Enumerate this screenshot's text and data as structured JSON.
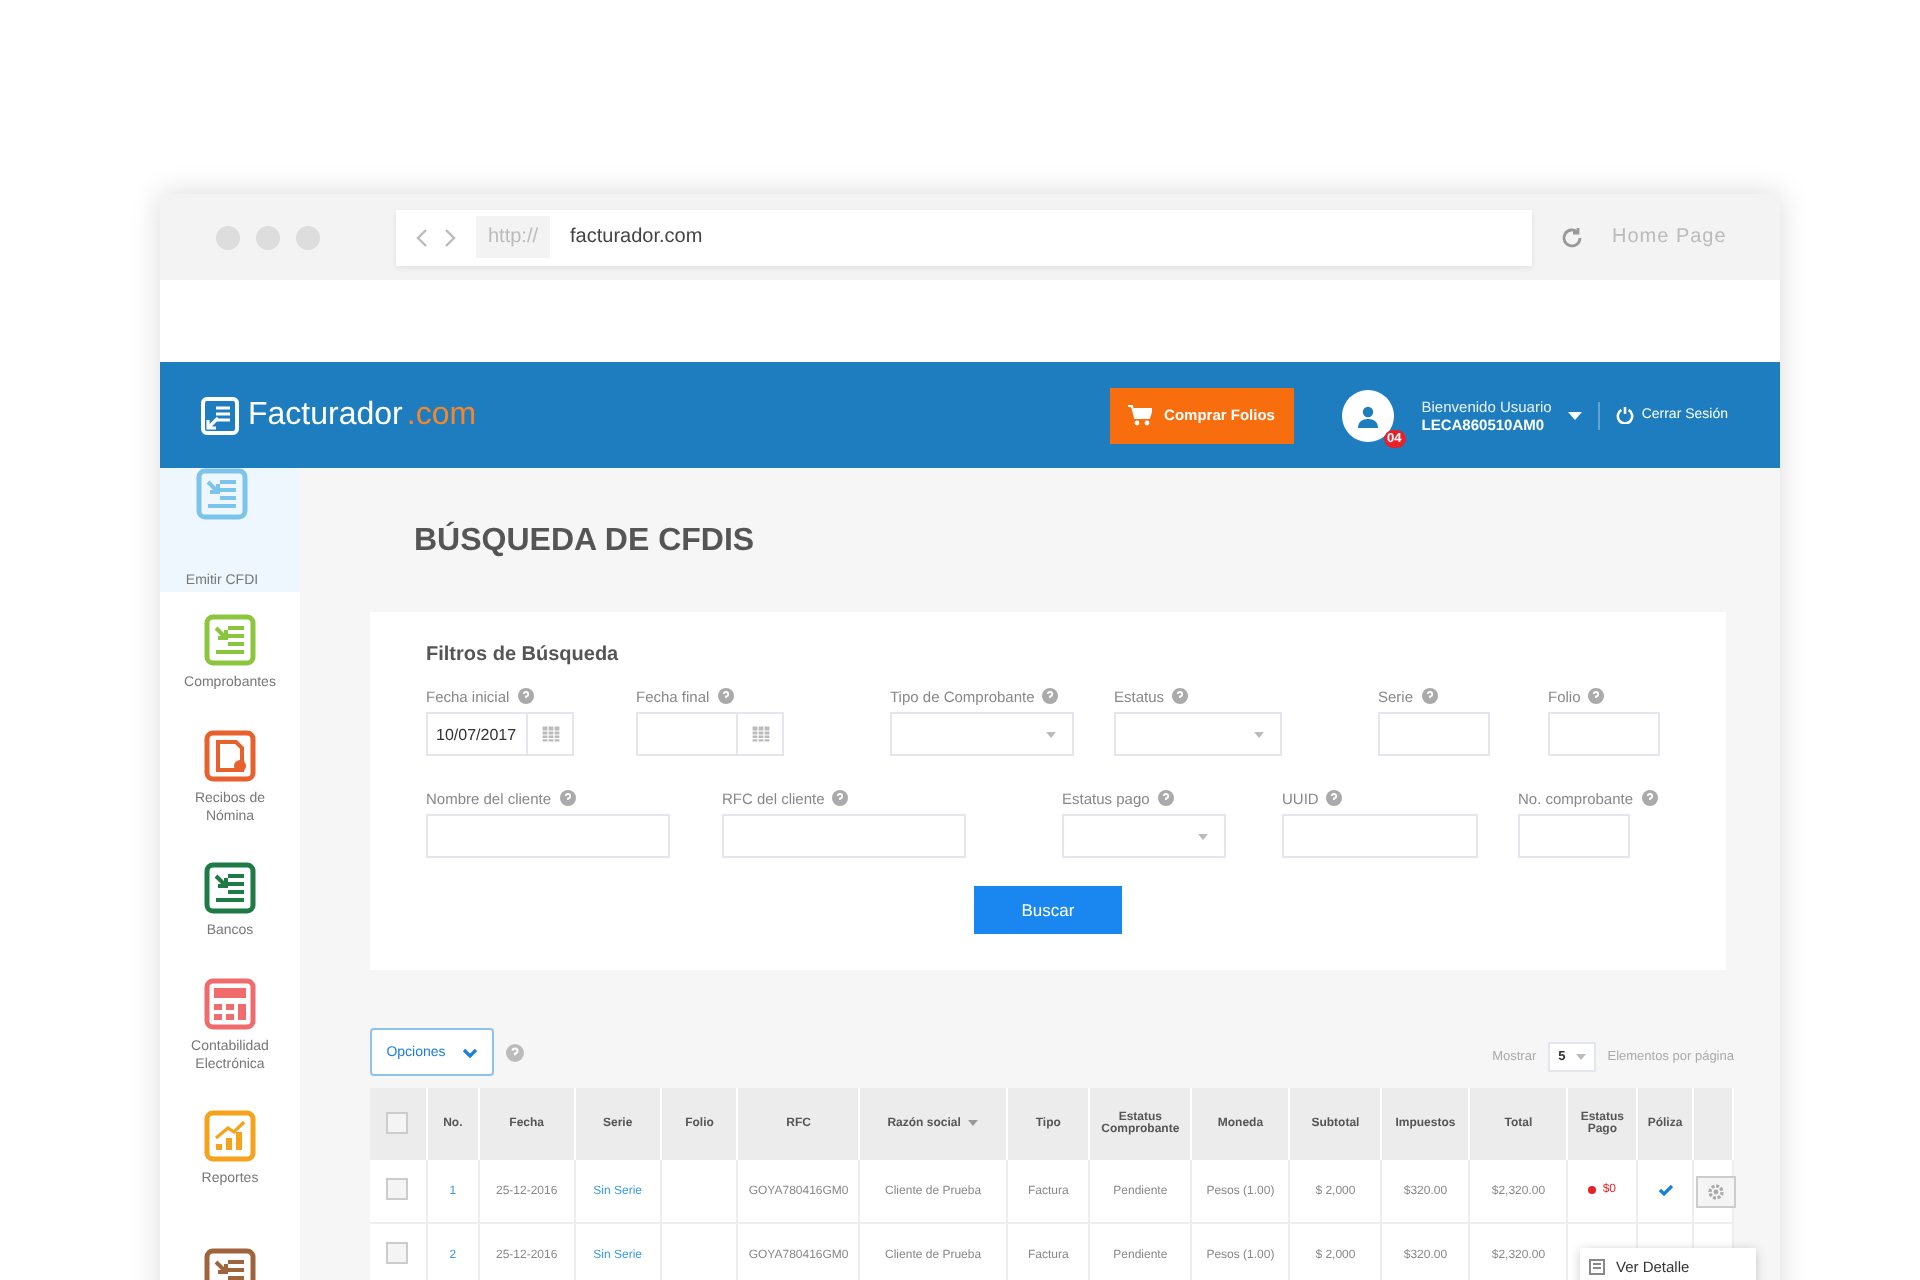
{
  "browser": {
    "protocol": "http://",
    "url": "facturador.com",
    "home": "Home Page"
  },
  "header": {
    "logo_main": "Facturador",
    "logo_suffix": ".com",
    "buy_button": "Comprar Folios",
    "user_greeting": "Bienvenido Usuario",
    "user_rfc": "LECA860510AM0",
    "notification_count": "04",
    "logout": "Cerrar Sesión"
  },
  "sidebar": {
    "items": [
      {
        "label": "Emitir CFDI",
        "kind": "emit",
        "color": "#7cc4ea",
        "selected": true
      },
      {
        "label": "Comprobantes",
        "kind": "docs",
        "color": "#8cc63e",
        "selected": false
      },
      {
        "label": "Recibos de Nómina",
        "kind": "receipt",
        "color": "#e8602c",
        "selected": false
      },
      {
        "label": "Bancos",
        "kind": "bank",
        "color": "#1e7b45",
        "selected": false
      },
      {
        "label": "Contabilidad Electrónica",
        "kind": "calc",
        "color": "#f06b6b",
        "selected": false
      },
      {
        "label": "Reportes",
        "kind": "chart",
        "color": "#f7a21b",
        "selected": false
      },
      {
        "kind": "docs",
        "color": "#a0643c",
        "selected": false
      }
    ]
  },
  "page_title": "BÚSQUEDA DE CFDIS",
  "filters": {
    "title": "Filtros de Búsqueda",
    "fields": [
      {
        "label": "Fecha inicial",
        "kind": "date",
        "value": "10/07/2017"
      },
      {
        "label": "Fecha final",
        "kind": "date"
      },
      {
        "label": "Tipo de Comprobante",
        "kind": "select"
      },
      {
        "label": "Estatus",
        "kind": "select"
      },
      {
        "label": "Serie",
        "kind": "text"
      },
      {
        "label": "Folio",
        "kind": "text"
      },
      {
        "label": "Nombre del cliente",
        "kind": "text"
      },
      {
        "label": "RFC  del cliente",
        "kind": "text"
      },
      {
        "label": "Estatus pago",
        "kind": "select"
      },
      {
        "label": "UUID",
        "kind": "text"
      },
      {
        "label": "No. comprobante",
        "kind": "text"
      }
    ],
    "search_button": "Buscar"
  },
  "toolbar": {
    "options_button": "Opciones",
    "show_label": "Mostrar",
    "page_size": "5",
    "per_page_label": "Elementos por página"
  },
  "table": {
    "select_all_checked": false,
    "columns": [
      "No.",
      "Fecha",
      "Serie",
      "Folio",
      "RFC",
      "Razón social",
      "Tipo",
      "Estatus Comprobante",
      "Moneda",
      "Subtotal",
      "Impuestos",
      "Total",
      "Estatus Pago",
      "Póliza"
    ],
    "rows": [
      {
        "checked": false,
        "no": "1",
        "fecha": "25-12-2016",
        "serie": "Sin Serie",
        "rfc": "GOYA780416GM0",
        "razon": "Cliente de Prueba",
        "tipo": "Factura",
        "estatus": "Pendiente",
        "moneda": "Pesos (1.00)",
        "subtotal": "$ 2,000",
        "impuestos": "$320.00",
        "total": "$2,320.00",
        "pago": {
          "text": "$0",
          "color": "#e8202a"
        },
        "poliza": true
      },
      {
        "checked": false,
        "no": "2",
        "fecha": "25-12-2016",
        "serie": "Sin Serie",
        "rfc": "GOYA780416GM0",
        "razon": "Cliente de Prueba",
        "tipo": "Factura",
        "estatus": "Pendiente",
        "moneda": "Pesos (1.00)",
        "subtotal": "$ 2,000",
        "impuestos": "$320.00",
        "total": "$2,320.00"
      }
    ]
  },
  "action_menu": {
    "items": [
      "Ver Detalle"
    ]
  }
}
